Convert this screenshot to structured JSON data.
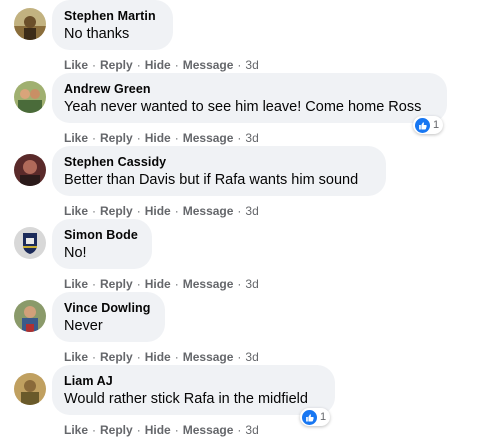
{
  "comments": [
    {
      "author": "Stephen Martin",
      "text": "No thanks",
      "actions": {
        "like": "Like",
        "reply": "Reply",
        "hide": "Hide",
        "message": "Message",
        "time": "3d"
      },
      "reaction_count": null,
      "avatar_colors": [
        "#8a6d3b",
        "#c2b280"
      ]
    },
    {
      "author": "Andrew Green",
      "text": "Yeah never wanted to see him leave! Come home Ross",
      "actions": {
        "like": "Like",
        "reply": "Reply",
        "hide": "Hide",
        "message": "Message",
        "time": "3d"
      },
      "reaction_count": "1",
      "avatar_colors": [
        "#4a6b3a",
        "#a0b070"
      ]
    },
    {
      "author": "Stephen Cassidy",
      "text": "Better than Davis but if Rafa wants him sound",
      "actions": {
        "like": "Like",
        "reply": "Reply",
        "hide": "Hide",
        "message": "Message",
        "time": "3d"
      },
      "reaction_count": null,
      "avatar_colors": [
        "#5a2a2a",
        "#b06a5a"
      ]
    },
    {
      "author": "Simon Bode",
      "text": "No!",
      "actions": {
        "like": "Like",
        "reply": "Reply",
        "hide": "Hide",
        "message": "Message",
        "time": "3d"
      },
      "reaction_count": null,
      "avatar_colors": [
        "#1b2a5a",
        "#d8d8d8"
      ]
    },
    {
      "author": "Vince Dowling",
      "text": "Never",
      "actions": {
        "like": "Like",
        "reply": "Reply",
        "hide": "Hide",
        "message": "Message",
        "time": "3d"
      },
      "reaction_count": null,
      "avatar_colors": [
        "#3a5a8a",
        "#8a9a6a"
      ]
    },
    {
      "author": "Liam AJ",
      "text": "Would rather stick Rafa in the midfield",
      "actions": {
        "like": "Like",
        "reply": "Reply",
        "hide": "Hide",
        "message": "Message",
        "time": "3d"
      },
      "reaction_count": "1",
      "avatar_colors": [
        "#6a5a2a",
        "#c0a060"
      ]
    }
  ],
  "colors": {
    "bubble": "#f0f2f5",
    "meta": "#65676b",
    "like_blue": "#1877f2"
  },
  "icons": {
    "reaction": "thumbs-up-icon"
  }
}
